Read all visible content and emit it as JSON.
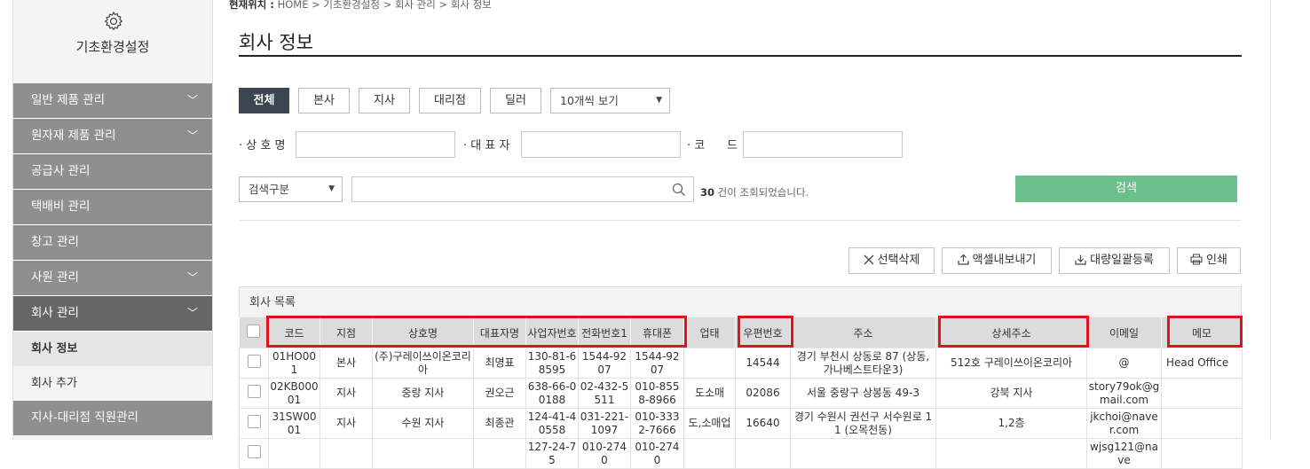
{
  "sidebar": {
    "title": "기초환경설정",
    "items": [
      {
        "label": "일반 제품 관리",
        "chevron": true
      },
      {
        "label": "원자재 제품 관리",
        "chevron": true
      },
      {
        "label": "공급사 관리",
        "chevron": false
      },
      {
        "label": "택배비 관리",
        "chevron": false
      },
      {
        "label": "창고 관리",
        "chevron": false
      },
      {
        "label": "사원 관리",
        "chevron": true
      },
      {
        "label": "회사 관리",
        "chevron": true
      }
    ],
    "sub_items": [
      "회사 정보",
      "회사 추가"
    ],
    "last_item": "지사-대리점 직원관리"
  },
  "breadcrumb": {
    "prefix": "현재위치 :",
    "path": "HOME > 기초환경설정 > 회사 관리 > 회사 정보"
  },
  "page_title": "회사 정보",
  "filters": {
    "tabs": [
      "전체",
      "본사",
      "지사",
      "대리점",
      "딜러"
    ],
    "page_size": "10개씩 보기",
    "labels": {
      "company": "· 상 호 명",
      "ceo": "· 대 표 자",
      "code": "· 코      드"
    },
    "search_type": "검색구분",
    "result_count": "30",
    "result_suffix": " 건이 조회되었습니다.",
    "search_button": "검색"
  },
  "actions": {
    "delete": "선택삭제",
    "excel": "액셀내보내기",
    "bulk": "대량일괄등록",
    "print": "인쇄"
  },
  "table": {
    "caption": "회사 목록",
    "headers": [
      "코드",
      "지점",
      "상호명",
      "대표자명",
      "사업자번호",
      "전화번호1",
      "휴대폰",
      "업태",
      "우편번호",
      "주소",
      "상세주소",
      "이메일",
      "메모"
    ],
    "rows": [
      [
        "01HO001",
        "본사",
        "(주)구레이쓰이온코리아",
        "최명표",
        "130-81-68595",
        "1544-9207",
        "1544-9207",
        "",
        "14544",
        "경기 부천시 상동로 87 (상동, 가나베스트타운3)",
        "512호 구레이쓰이온코리아",
        "@",
        "Head Office"
      ],
      [
        "02KB00001",
        "지사",
        "중랑 지사",
        "권오근",
        "638-66-00188",
        "02-432-5511",
        "010-8558-8966",
        "도소매",
        "02086",
        "서울 중랑구 상봉동 49-3",
        "강북 지사",
        "story79ok@gmail.com",
        ""
      ],
      [
        "31SW0001",
        "지사",
        "수원 지사",
        "최종관",
        "124-41-40558",
        "031-221-1097",
        "010-3332-7666",
        "도,소매업",
        "16640",
        "경기 수원시 권선구 서수원로 11 (오목천동)",
        "1,2층",
        "jkchoi@naver.com",
        ""
      ],
      [
        "",
        "",
        "",
        "",
        "127-24-75",
        "010-2740",
        "010-2740",
        "",
        "",
        "",
        "",
        "wjsg121@nave",
        ""
      ]
    ]
  },
  "colors": {
    "menu_bg": "#8f8f8f",
    "menu_active": "#666666",
    "tab_active": "#3c4550",
    "search_green": "#6abf8a",
    "highlight_red": "#e1141e"
  }
}
